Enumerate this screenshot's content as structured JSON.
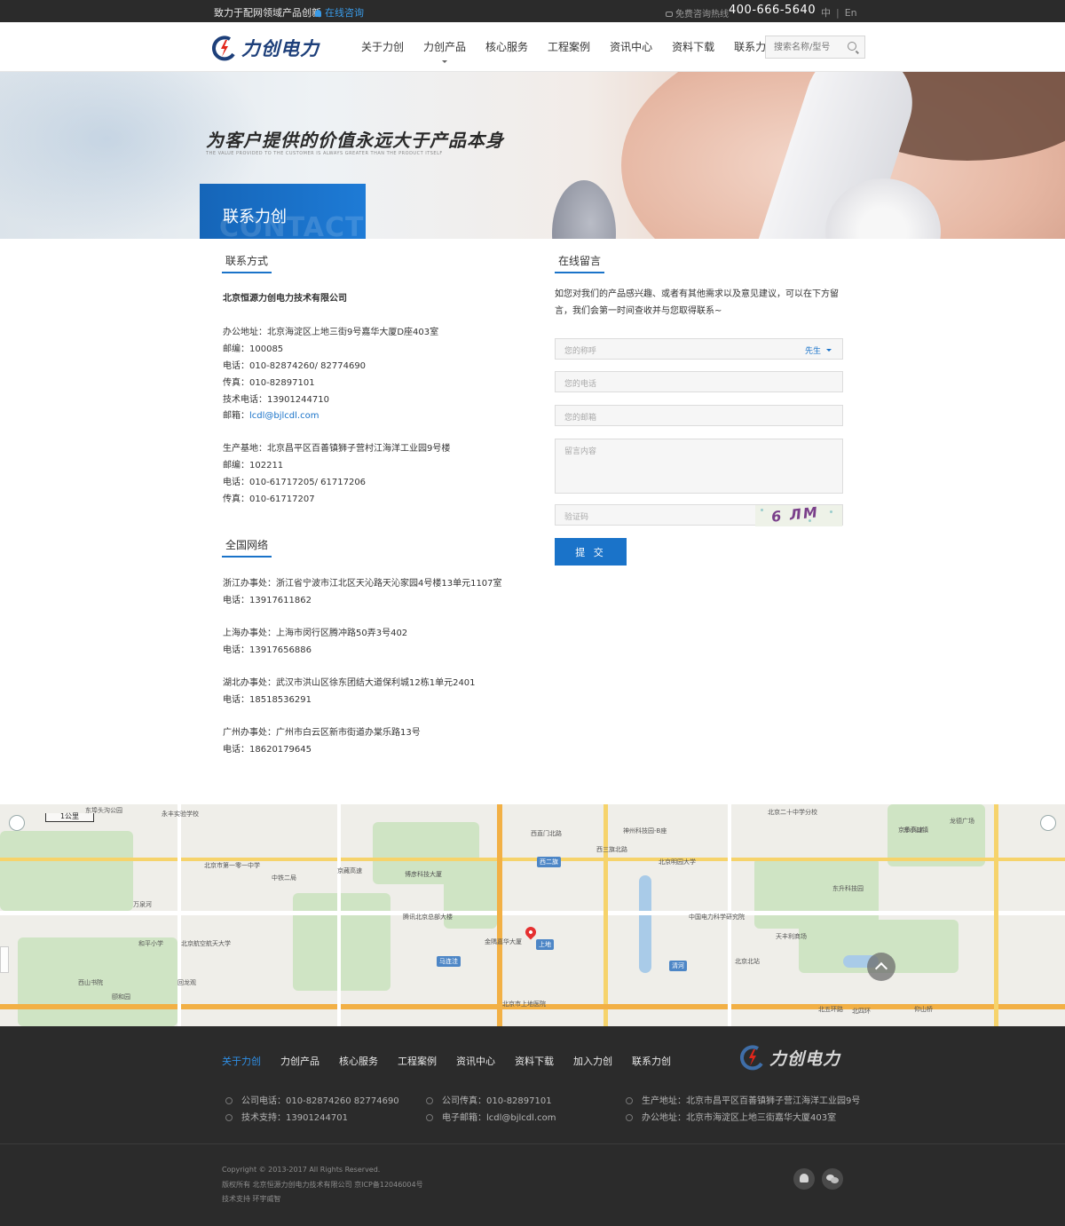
{
  "topbar": {
    "slogan": "致力于配网领域产品创新",
    "consult": "在线咨询",
    "hotline_label": "免费咨询热线",
    "hotline": "400-666-5640",
    "lang_cn": "中",
    "lang_sep": "|",
    "lang_en": "En"
  },
  "header": {
    "logo_text": "力创电力",
    "nav": [
      "关于力创",
      "力创产品",
      "核心服务",
      "工程案例",
      "资讯中心",
      "资料下载",
      "联系力创"
    ],
    "search_placeholder": "搜索名称/型号"
  },
  "banner": {
    "tagline": "为客户提供的价值永远大于产品本身",
    "tagline_en": "THE VALUE PROVIDED TO THE CUSTOMER IS ALWAYS GREATER THAN THE PRODUCT ITSELF",
    "section_cn": "联系力创",
    "section_en": "CONTACT US"
  },
  "contact": {
    "title": "联系方式",
    "company": "北京恒源力创电力技术有限公司",
    "office": [
      "办公地址：北京海淀区上地三街9号嘉华大厦D座403室",
      "邮编：100085",
      "电话：010-82874260/ 82774690",
      "传真：010-82897101",
      "技术电话：13901244710"
    ],
    "email_label": "邮箱：",
    "email": "lcdl@bjlcdl.com",
    "factory": [
      "生产基地：北京昌平区百善镇狮子营村江海洋工业园9号楼",
      "邮编：102211",
      "电话：010-61717205/ 61717206",
      "传真：010-61717207"
    ]
  },
  "network": {
    "title": "全国网络",
    "offices": [
      {
        "addr": "浙江办事处：浙江省宁波市江北区天沁路天沁家园4号楼13单元1107室",
        "tel": "电话：13917611862"
      },
      {
        "addr": "上海办事处：上海市闵行区腾冲路50弄3号402",
        "tel": "电话：13917656886"
      },
      {
        "addr": "湖北办事处：武汉市洪山区徐东团结大道保利城12栋1单元2401",
        "tel": "电话：18518536291"
      },
      {
        "addr": "广州办事处：广州市白云区新市街道办棠乐路13号",
        "tel": "电话：18620179645"
      }
    ]
  },
  "message": {
    "title": "在线留言",
    "intro": "如您对我们的产品感兴趣、或者有其他需求以及意见建议，可以在下方留言，我们会第一时间查收并与您取得联系~",
    "name_placeholder": "您的称呼",
    "gender": "先生",
    "phone_placeholder": "您的电话",
    "email_placeholder": "您的邮箱",
    "content_placeholder": "留言内容",
    "captcha_placeholder": "验证码",
    "captcha_text": "6 ЛМ",
    "submit": "提 交"
  },
  "map": {
    "scale": "1公里",
    "labels": {
      "l01": "东埠头沟公园",
      "l02": "永丰实验学校",
      "l03": "西直门北路",
      "l04": "西三旗北路",
      "l05": "京藏高速",
      "l06": "神州科技园-B座",
      "l07": "北京二十中学分校",
      "l08": "京承高速",
      "l09": "东小口镇",
      "l10": "龙德广场",
      "l11": "万泉河",
      "l12": "中铁二局",
      "l13": "博彦科技大厦",
      "l14": "西二旗",
      "l15": "上地",
      "l16": "马连洼",
      "l17": "金隅嘉华大厦",
      "l18": "北京市上地医院",
      "l19": "清河",
      "l20": "中国电力科学研究院",
      "l21": "北京明园大学",
      "l22": "东升科技园",
      "l23": "北京北站",
      "l24": "天丰利商场",
      "l25": "北五环路",
      "l26": "北四环",
      "l27": "仰山桥",
      "l28": "北京市第一零一中学",
      "l29": "腾讯北京总部大楼",
      "l30": "和平小学",
      "l31": "北京航空航天大学",
      "l32": "西山书院",
      "l33": "颐和园",
      "l34": "回龙观"
    }
  },
  "footer": {
    "nav": [
      "关于力创",
      "力创产品",
      "核心服务",
      "工程案例",
      "资讯中心",
      "资料下载",
      "加入力创",
      "联系力创"
    ],
    "logo_text": "力创电力",
    "phone": "公司电话：010-82874260 82774690",
    "support": "技术支持：13901244701",
    "fax": "公司传真：010-82897101",
    "email": "电子邮箱：lcdl@bjlcdl.com",
    "factory": "生产地址：北京市昌平区百善镇狮子营江海洋工业园9号",
    "office": "办公地址：北京市海淀区上地三街嘉华大厦403室",
    "copyright": "Copyright © 2013-2017 All Rights Reserved.",
    "record": "版权所有 北京恒源力创电力技术有限公司 京ICP备12046004号",
    "tech": "技术支持 环宇威智"
  },
  "colors": {
    "accent": "#1a73c9",
    "dark": "#2b2b2b",
    "logo": "#1d3f7a"
  }
}
